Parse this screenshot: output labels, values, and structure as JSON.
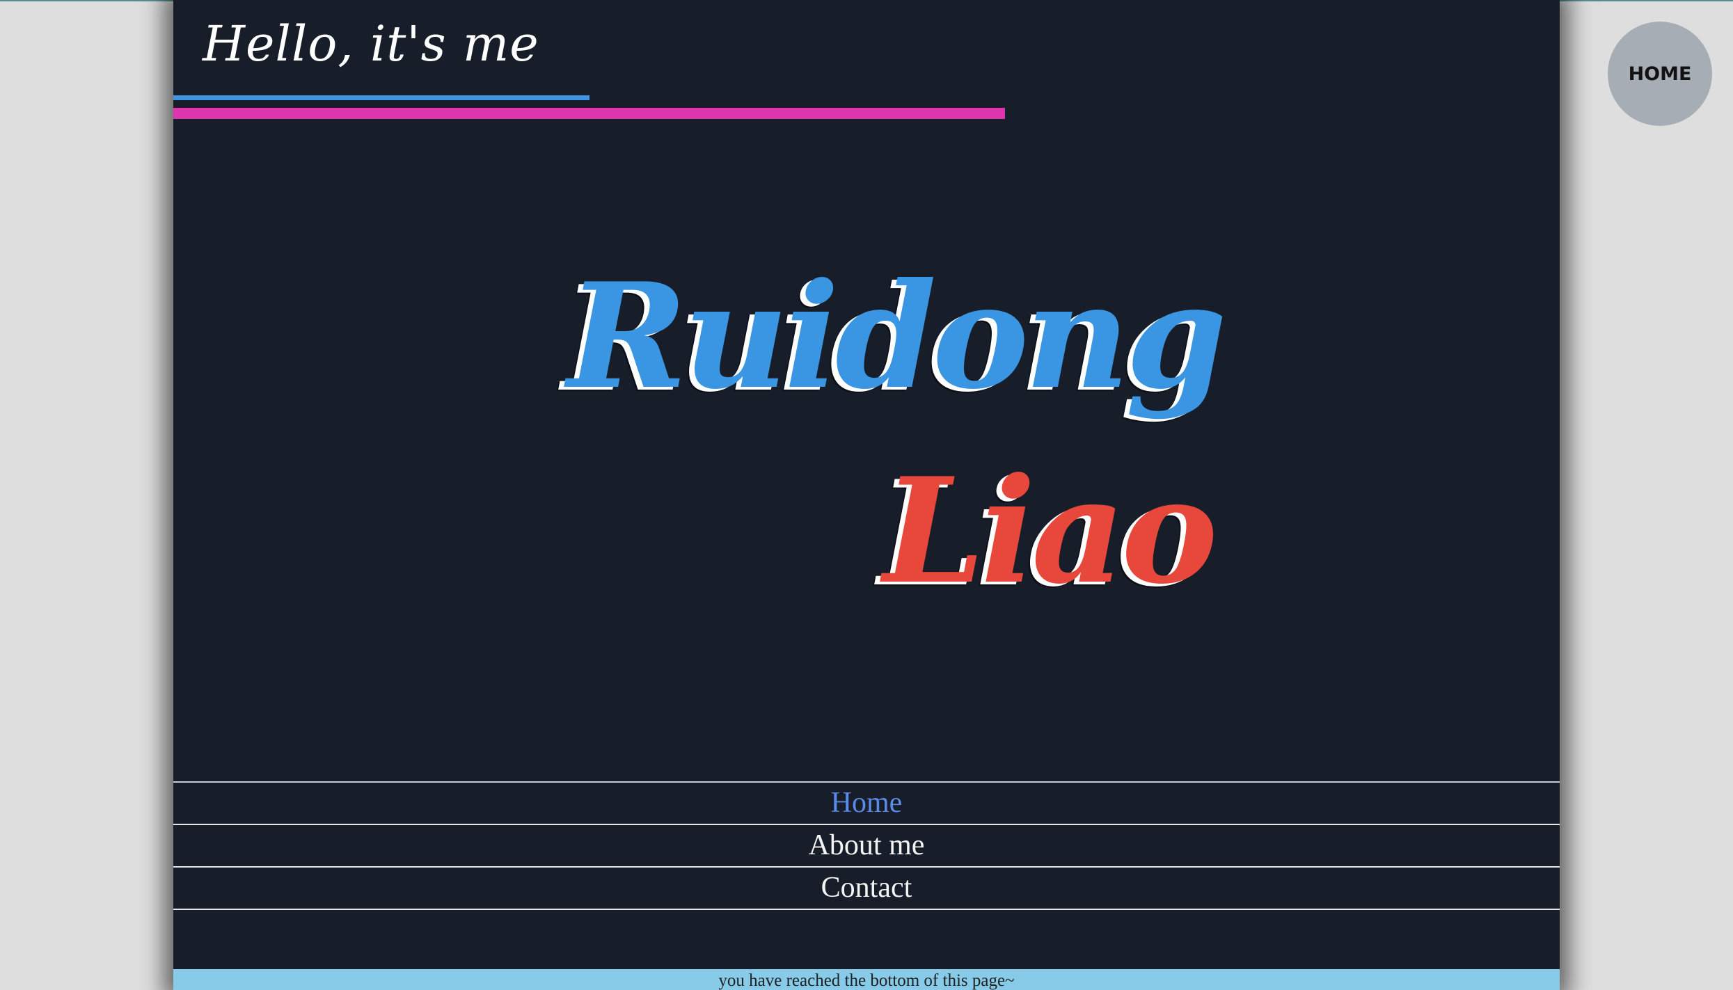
{
  "header": {
    "greeting": "Hello, it's me"
  },
  "hero": {
    "first_name": "Ruidong",
    "last_name": "Liao"
  },
  "nav": {
    "items": [
      {
        "label": "Home",
        "active": true
      },
      {
        "label": "About me",
        "active": false
      },
      {
        "label": "Contact",
        "active": false
      }
    ]
  },
  "footer": {
    "text": "you have reached the bottom of  this page~"
  },
  "home_button": {
    "label": "HOME"
  },
  "colors": {
    "page_background": "#181e29",
    "accent_blue": "#3e94e0",
    "accent_pink": "#dc35ad",
    "first_name": "#3a95e2",
    "last_name": "#e8483b",
    "active_nav": "#5a8be8",
    "footer_background": "#87cbe8"
  }
}
